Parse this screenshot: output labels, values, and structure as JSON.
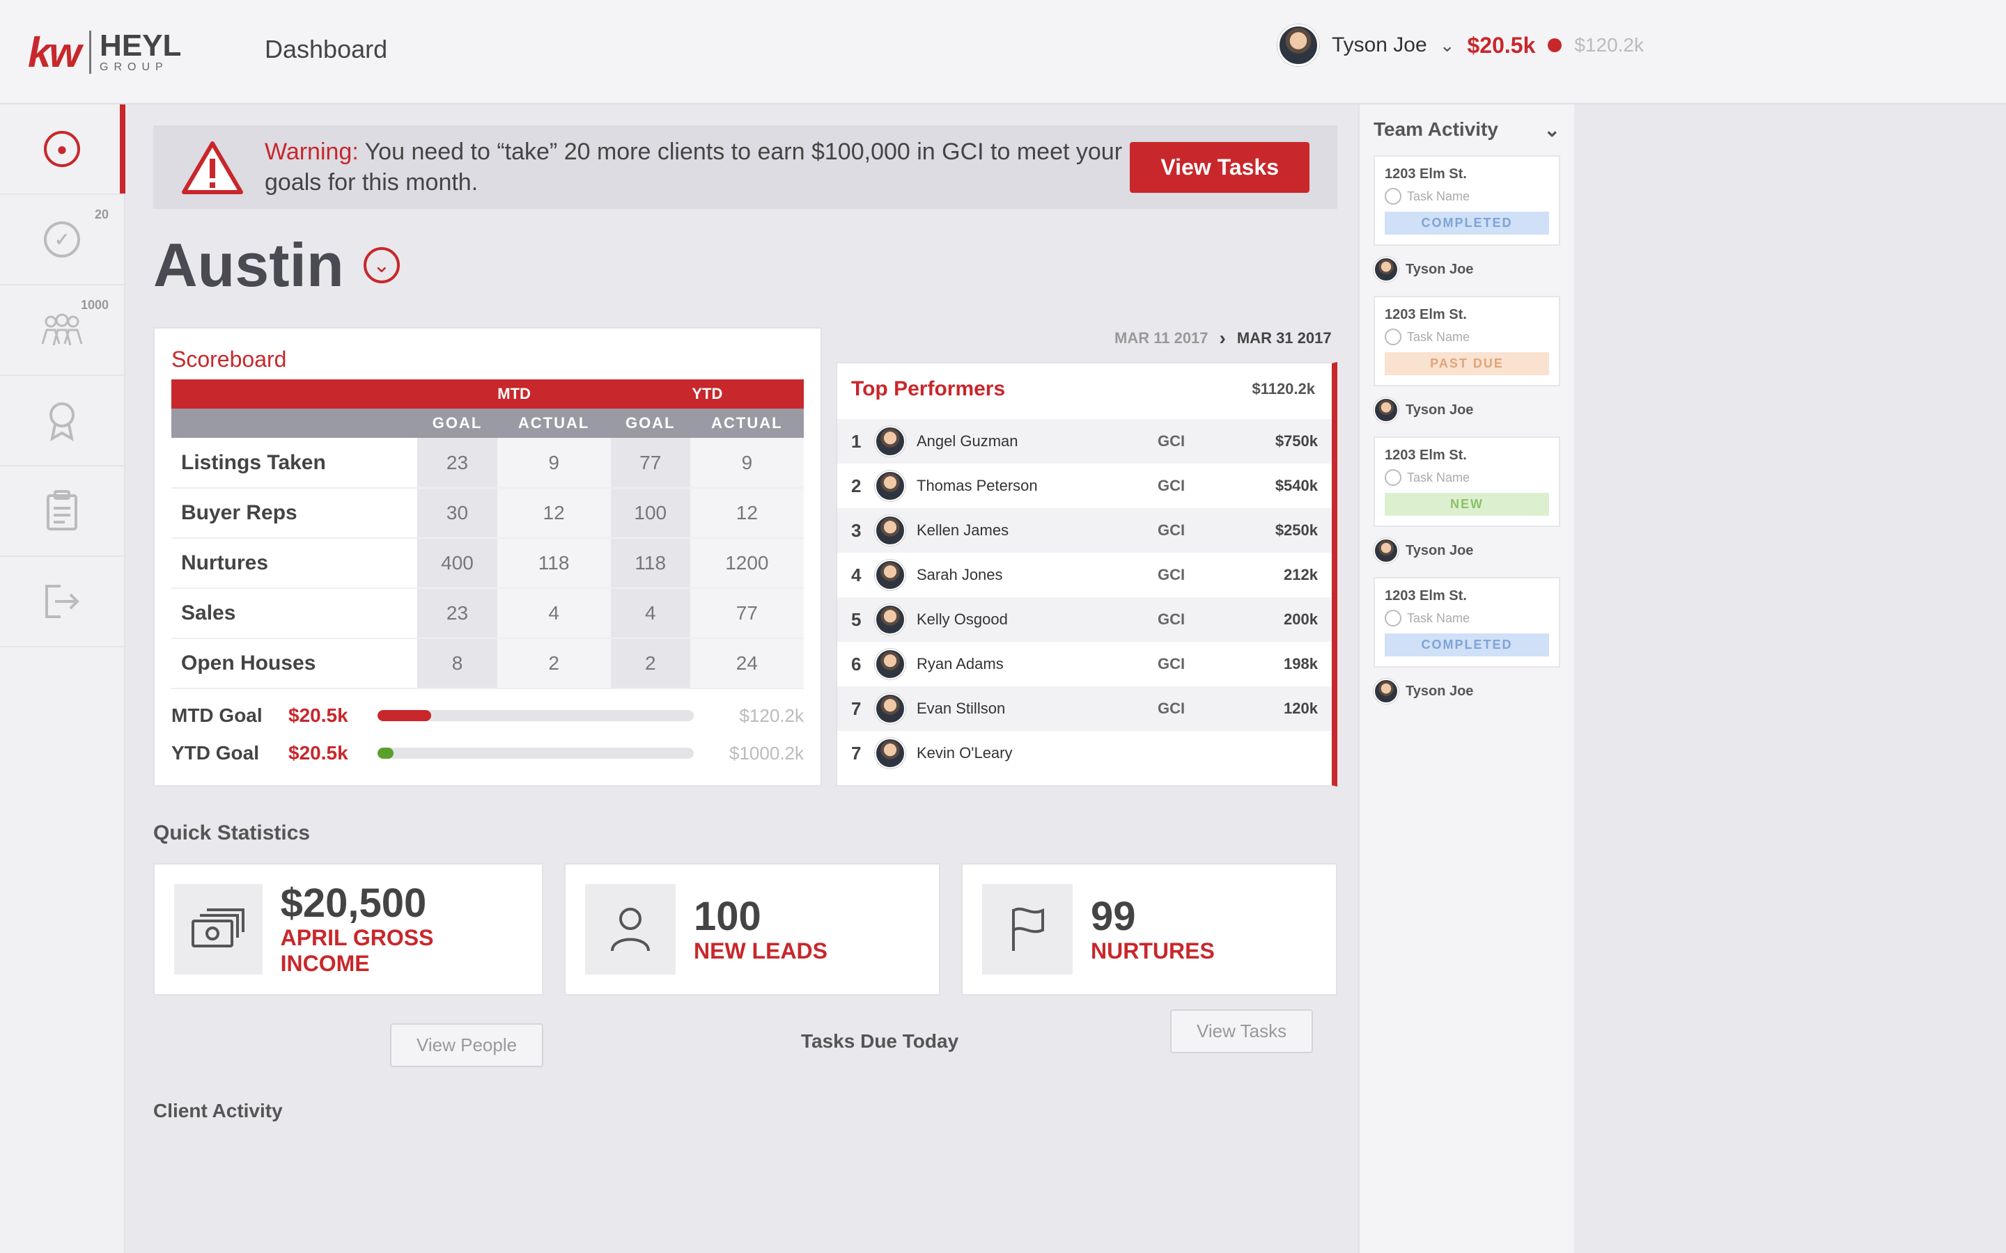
{
  "header": {
    "logo_kw": "kw",
    "logo_brand": "HEYL",
    "logo_sub": "GROUP",
    "page_title": "Dashboard",
    "user_name": "Tyson Joe",
    "current_amount": "$20.5k",
    "goal_amount": "$120.2k"
  },
  "sidebar": {
    "items": [
      {
        "icon": "dashboard-icon",
        "badge": ""
      },
      {
        "icon": "tasks-icon",
        "badge": "20"
      },
      {
        "icon": "people-icon",
        "badge": "1000"
      },
      {
        "icon": "award-icon",
        "badge": ""
      },
      {
        "icon": "clipboard-icon",
        "badge": ""
      },
      {
        "icon": "logout-icon",
        "badge": ""
      }
    ]
  },
  "warning": {
    "label": "Warning:",
    "message": " You need to “take” 20 more clients to earn $100,000 in GCI to meet your goals for this month.",
    "button": "View Tasks"
  },
  "city": "Austin",
  "scoreboard": {
    "title": "Scoreboard",
    "groups": [
      "MTD",
      "YTD"
    ],
    "subheads": [
      "GOAL",
      "ACTUAL",
      "GOAL",
      "ACTUAL"
    ],
    "rows": [
      {
        "label": "Listings Taken",
        "values": [
          "23",
          "9",
          "77",
          "9"
        ]
      },
      {
        "label": "Buyer Reps",
        "values": [
          "30",
          "12",
          "100",
          "12"
        ]
      },
      {
        "label": "Nurtures",
        "values": [
          "400",
          "118",
          "118",
          "1200"
        ]
      },
      {
        "label": "Sales",
        "values": [
          "23",
          "4",
          "4",
          "77"
        ]
      },
      {
        "label": "Open Houses",
        "values": [
          "8",
          "2",
          "2",
          "24"
        ]
      }
    ],
    "goals": [
      {
        "label": "MTD Goal",
        "amount": "$20.5k",
        "target": "$120.2k",
        "progress": 0.17,
        "color": "#c8272b"
      },
      {
        "label": "YTD Goal",
        "amount": "$20.5k",
        "target": "$1000.2k",
        "progress": 0.05,
        "color": "#5aa02c"
      }
    ]
  },
  "date_range": {
    "start": "MAR 11 2017",
    "end": "MAR 31 2017"
  },
  "top_performers": {
    "title": "Top Performers",
    "header_value": "$1120.2k",
    "rows": [
      {
        "rank": "1",
        "name": "Angel Guzman",
        "type": "GCI",
        "value": "$750k"
      },
      {
        "rank": "2",
        "name": "Thomas Peterson",
        "type": "GCI",
        "value": "$540k"
      },
      {
        "rank": "3",
        "name": "Kellen James",
        "type": "GCI",
        "value": "$250k"
      },
      {
        "rank": "4",
        "name": "Sarah Jones",
        "type": "GCI",
        "value": "212k"
      },
      {
        "rank": "5",
        "name": "Kelly Osgood",
        "type": "GCI",
        "value": "200k"
      },
      {
        "rank": "6",
        "name": "Ryan Adams",
        "type": "GCI",
        "value": "198k"
      },
      {
        "rank": "7",
        "name": "Evan Stillson",
        "type": "GCI",
        "value": "120k"
      },
      {
        "rank": "7",
        "name": "Kevin O'Leary",
        "type": "",
        "value": ""
      }
    ]
  },
  "quick_stats": {
    "title": "Quick Statistics",
    "cards": [
      {
        "icon": "cash-icon",
        "value": "$20,500",
        "label": "APRIL GROSS INCOME"
      },
      {
        "icon": "person-icon",
        "value": "100",
        "label": "NEW LEADS"
      },
      {
        "icon": "flag-icon",
        "value": "99",
        "label": "NURTURES"
      }
    ],
    "view_people": "View People",
    "view_tasks": "View Tasks",
    "tasks_due_today": "Tasks Due Today",
    "client_activity": "Client Activity"
  },
  "team_activity": {
    "title": "Team Activity",
    "items": [
      {
        "address": "1203 Elm St.",
        "task": "Task Name",
        "status": "COMPLETED",
        "status_color": "#cfe0f7",
        "status_text_color": "#7fa3d6",
        "person": "Tyson Joe"
      },
      {
        "address": "1203 Elm St.",
        "task": "Task Name",
        "status": "PAST DUE",
        "status_color": "#f9e2d0",
        "status_text_color": "#e0a47a",
        "person": "Tyson Joe"
      },
      {
        "address": "1203 Elm St.",
        "task": "Task Name",
        "status": "NEW",
        "status_color": "#dcf0d0",
        "status_text_color": "#8cc06a",
        "person": "Tyson Joe"
      },
      {
        "address": "1203 Elm St.",
        "task": "Task Name",
        "status": "COMPLETED",
        "status_color": "#cfe0f7",
        "status_text_color": "#7fa3d6",
        "person": "Tyson Joe"
      }
    ]
  }
}
